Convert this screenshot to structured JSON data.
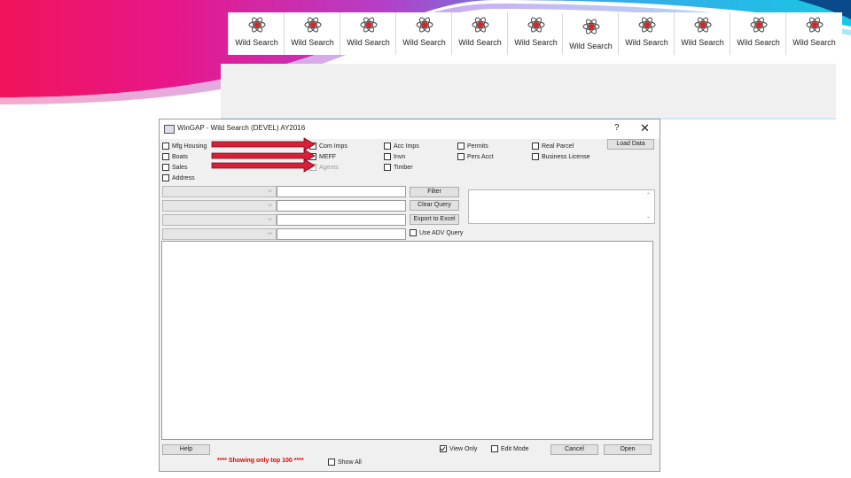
{
  "tabs": [
    {
      "label": "Wild Search"
    },
    {
      "label": "Wild Search"
    },
    {
      "label": "Wild Search"
    },
    {
      "label": "Wild Search"
    },
    {
      "label": "Wild Search"
    },
    {
      "label": "Wild Search"
    },
    {
      "label": "Wild Search"
    },
    {
      "label": "Wild Search"
    },
    {
      "label": "Wild Search"
    },
    {
      "label": "Wild Search"
    },
    {
      "label": "Wild Search"
    }
  ],
  "window": {
    "title": "WinGAP - Wild Search (DEVEL) AY2016",
    "help_glyph": "?",
    "close_glyph": "✕"
  },
  "checkboxes": {
    "mfg_housing": "Mfg Housing",
    "boats": "Boats",
    "sales": "Sales",
    "address": "Address",
    "com_imps": "Com Imps",
    "meff": "MEFF",
    "agents": "Agents",
    "acc_imps": "Acc Imps",
    "invn": "Invn",
    "timber": "Timber",
    "permits": "Permits",
    "pers_acct": "Pers Acct",
    "real_parcel": "Real Parcel",
    "business_license": "Business License",
    "use_adv_query": "Use ADV Query",
    "view_only": "View Only",
    "edit_mode": "Edit Mode",
    "show_all": "Show All"
  },
  "buttons": {
    "load_data": "Load Data",
    "filter": "Filter",
    "clear_query": "Clear Query",
    "export_to_excel": "Export to Excel",
    "help": "Help",
    "cancel": "Cancel",
    "open": "Open"
  },
  "status_text": "**** Showing only top 100 ****",
  "icons": {
    "atom": "atom-icon",
    "chevron": "chevron-down-icon",
    "scroll_up": "scroll-up-icon",
    "scroll_down": "scroll-down-icon"
  },
  "colors": {
    "arrow": "#d81f3a",
    "status": "#e00000",
    "banner_magenta": "#e8168a",
    "banner_cyan": "#19c6e6"
  }
}
